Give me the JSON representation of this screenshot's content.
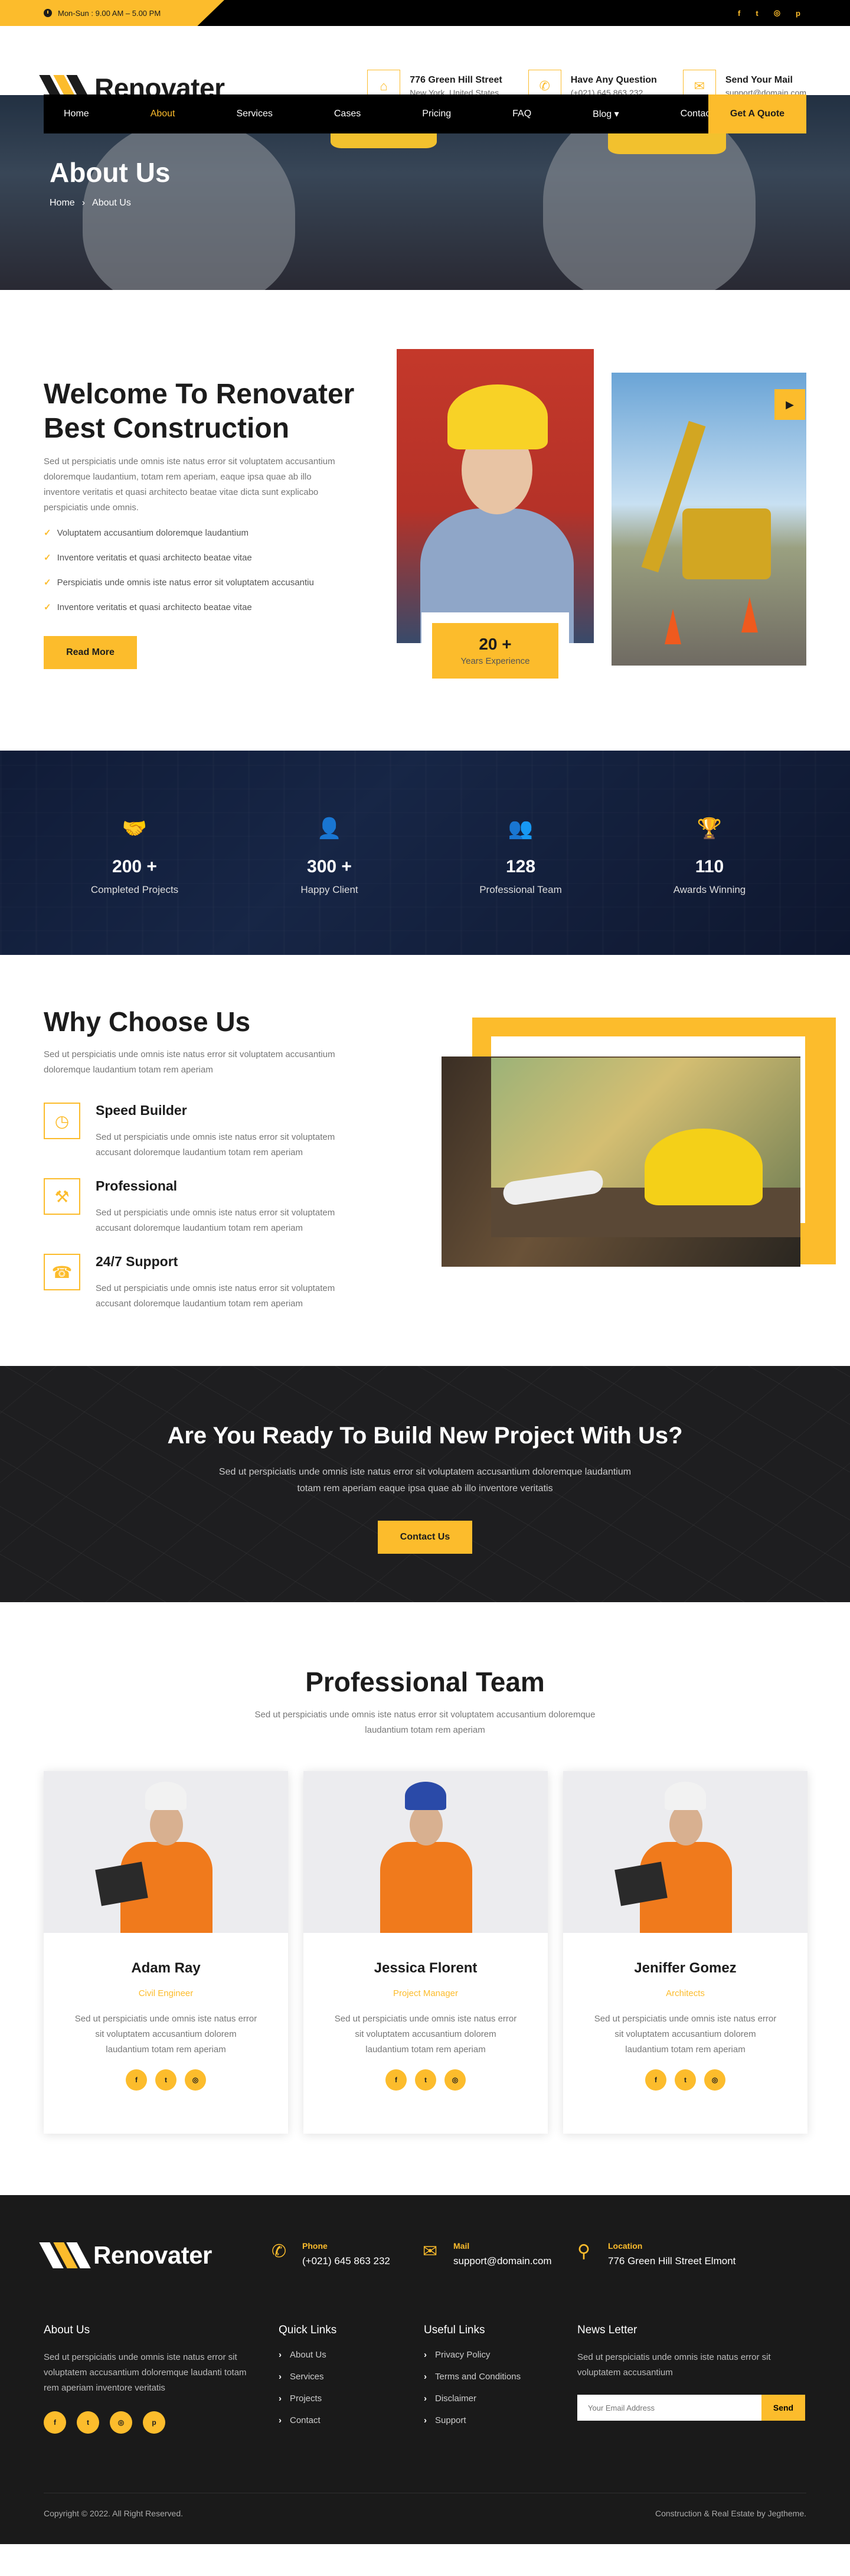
{
  "topbar": {
    "hours": "Mon-Sun : 9.00 AM – 5.00 PM",
    "socials": [
      {
        "icon": "facebook-icon",
        "glyph": "f"
      },
      {
        "icon": "twitter-icon",
        "glyph": "t"
      },
      {
        "icon": "instagram-icon",
        "glyph": "◎"
      },
      {
        "icon": "pinterest-icon",
        "glyph": "p"
      }
    ]
  },
  "brand": {
    "name": "Renovater",
    "accent": "#fcbc2c",
    "dark": "#1c1c1c"
  },
  "header": {
    "contacts": [
      {
        "icon": "home-icon",
        "glyph": "⌂",
        "title": "776 Green Hill Street",
        "sub": "New York, United States"
      },
      {
        "icon": "phone-icon",
        "glyph": "✆",
        "title": "Have Any Question",
        "sub": "(+021) 645 863 232"
      },
      {
        "icon": "mail-icon",
        "glyph": "✉",
        "title": "Send Your Mail",
        "sub": "support@domain.com"
      }
    ]
  },
  "nav": {
    "items": [
      "Home",
      "About",
      "Services",
      "Cases",
      "Pricing",
      "FAQ",
      "Blog ▾",
      "Contact"
    ],
    "active": "About",
    "cta": "Get A Quote"
  },
  "hero": {
    "title": "About Us",
    "crumbs": [
      "Home",
      "›",
      "About Us"
    ]
  },
  "about": {
    "title": "Welcome To Renovater Best Construction",
    "desc": "Sed ut perspiciatis unde omnis iste natus error sit voluptatem accusantium doloremque laudantium, totam rem aperiam, eaque ipsa quae ab illo inventore veritatis et quasi architecto beatae vitae dicta sunt explicabo perspiciatis unde omnis.",
    "list": [
      "Voluptatem accusantium doloremque laudantium",
      "Inventore veritatis et quasi architecto beatae vitae",
      "Perspiciatis unde omnis iste natus error sit voluptatem accusantiu",
      "Inventore veritatis et quasi architecto beatae vitae"
    ],
    "button": "Read More",
    "experience_num": "20 +",
    "experience_label": "Years Experience",
    "play_glyph": "▶"
  },
  "stats": [
    {
      "icon": "handshake-icon",
      "glyph": "🤝",
      "num": "200 +",
      "label": "Completed Projects"
    },
    {
      "icon": "client-icon",
      "glyph": "👤",
      "num": "300 +",
      "label": "Happy Client"
    },
    {
      "icon": "team-icon",
      "glyph": "👥",
      "num": "128",
      "label": "Professional Team"
    },
    {
      "icon": "trophy-icon",
      "glyph": "🏆",
      "num": "110",
      "label": "Awards Winning"
    }
  ],
  "why": {
    "title": "Why Choose Us",
    "desc": "Sed ut perspiciatis unde omnis iste natus error sit voluptatem accusantium doloremque laudantium totam rem aperiam",
    "features": [
      {
        "icon": "speed-icon",
        "glyph": "◷",
        "title": "Speed Builder",
        "text": "Sed ut perspiciatis unde omnis iste natus error sit voluptatem accusant doloremque laudantium totam rem aperiam"
      },
      {
        "icon": "worker-team-icon",
        "glyph": "⚒",
        "title": "Professional",
        "text": "Sed ut perspiciatis unde omnis iste natus error sit voluptatem accusant doloremque laudantium totam rem aperiam"
      },
      {
        "icon": "support-icon",
        "glyph": "☎",
        "title": "24/7 Support",
        "text": "Sed ut perspiciatis unde omnis iste natus error sit voluptatem accusant doloremque laudantium totam rem aperiam"
      }
    ]
  },
  "cta": {
    "title": "Are You Ready To Build New Project With Us?",
    "desc": "Sed ut perspiciatis unde omnis iste natus error sit voluptatem accusantium doloremque laudantium totam rem aperiam eaque ipsa quae ab illo inventore veritatis",
    "button": "Contact Us"
  },
  "team": {
    "title": "Professional Team",
    "desc": "Sed ut perspiciatis unde omnis iste natus error sit voluptatem accusantium doloremque laudantium totam rem aperiam",
    "members": [
      {
        "name": "Adam Ray",
        "role": "Civil Engineer",
        "hat": "#f2f2f2",
        "bio": "Sed ut perspiciatis unde omnis iste natus error sit voluptatem accusantium dolorem laudantium totam rem aperiam"
      },
      {
        "name": "Jessica Florent",
        "role": "Project Manager",
        "hat": "#2a4aa8",
        "bio": "Sed ut perspiciatis unde omnis iste natus error sit voluptatem accusantium dolorem laudantium totam rem aperiam"
      },
      {
        "name": "Jeniffer Gomez",
        "role": "Architects",
        "hat": "#f2f2f2",
        "bio": "Sed ut perspiciatis unde omnis iste natus error sit voluptatem accusantium dolorem laudantium totam rem aperiam"
      }
    ],
    "socials": [
      "f",
      "t",
      "◎"
    ]
  },
  "footer": {
    "info": [
      {
        "icon": "phone-icon",
        "glyph": "✆",
        "label": "Phone",
        "value": "(+021) 645 863 232"
      },
      {
        "icon": "mail-icon",
        "glyph": "✉",
        "label": "Mail",
        "value": "support@domain.com"
      },
      {
        "icon": "location-icon",
        "glyph": "⚲",
        "label": "Location",
        "value": "776 Green Hill Street Elmont"
      }
    ],
    "about_title": "About Us",
    "about_text": "Sed ut perspiciatis unde omnis iste natus error sit voluptatem accusantium doloremque laudanti totam rem aperiam inventore veritatis",
    "about_socials": [
      "f",
      "t",
      "◎",
      "p"
    ],
    "quick_title": "Quick Links",
    "quick_links": [
      "About Us",
      "Services",
      "Projects",
      "Contact"
    ],
    "useful_title": "Useful Links",
    "useful_links": [
      "Privacy Policy",
      "Terms and Conditions",
      "Disclaimer",
      "Support"
    ],
    "news_title": "News Letter",
    "news_text": "Sed ut perspiciatis unde omnis iste natus error sit voluptatem accusantium",
    "news_placeholder": "Your Email Address",
    "news_button": "Send",
    "copyright": "Copyright © 2022. All Right Reserved.",
    "credit": "Construction & Real Estate by Jegtheme."
  }
}
